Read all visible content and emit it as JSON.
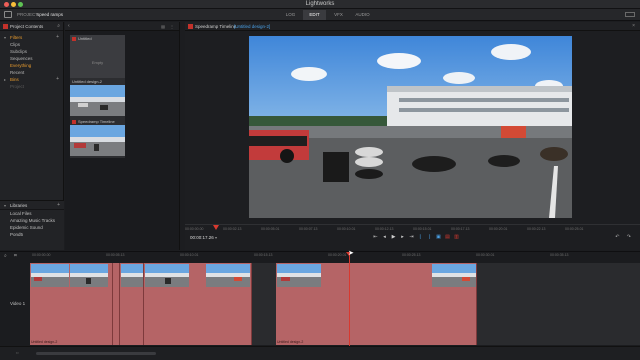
{
  "window": {
    "title": "Lightworks"
  },
  "topbar": {
    "project_label": "PROJECT",
    "project_name": "speed ramps",
    "tabs": [
      "LOG",
      "EDIT",
      "VFX",
      "AUDIO"
    ],
    "active_tab": "EDIT"
  },
  "project_panel": {
    "title": "Project Contents",
    "items": [
      {
        "label": "Filters",
        "color": "#e69a2e",
        "type": "section",
        "caret": "▾"
      },
      {
        "label": "Clips",
        "type": "child"
      },
      {
        "label": "Subclips",
        "type": "child"
      },
      {
        "label": "Sequences",
        "type": "child"
      },
      {
        "label": "Everything",
        "type": "child",
        "color": "#e69a2e"
      },
      {
        "label": "Recent",
        "type": "child"
      },
      {
        "label": "Bins",
        "color": "#e69a2e",
        "type": "section",
        "caret": "▸"
      },
      {
        "label": "Project",
        "type": "child",
        "dim": true
      }
    ]
  },
  "libraries": {
    "title": "Libraries",
    "items": [
      "Local Files",
      "Amazing Music Tracks",
      "Epidemic Sound",
      "Pond5"
    ]
  },
  "bin": {
    "tiles": [
      {
        "title": "Untitled",
        "body": "Empty",
        "kind": "empty"
      },
      {
        "title": "Untitled design-2",
        "kind": "thumb"
      },
      {
        "title": "Speedramp Timeline",
        "kind": "thumb",
        "red": true
      }
    ]
  },
  "viewer": {
    "title": "Speedramp Timeline",
    "subtitle": "[Untitled design-2]",
    "timecode": "00:00:17.26",
    "ruler_ticks": [
      "00:00:00.00",
      "00:00:02.13",
      "00:00:05.01",
      "00:00:07.13",
      "00:00:10.01",
      "00:00:12.13",
      "00:00:15.01",
      "00:00:17.13",
      "00:00:20.01",
      "00:00:22.13",
      "00:00:25.01"
    ]
  },
  "timeline": {
    "track_label": "Video 1",
    "ruler_ticks": [
      "00:00:00.00",
      "00:00:05.13",
      "00:00:10.01",
      "00:00:15.13",
      "00:00:20.01",
      "00:00:25.13",
      "00:00:30.01",
      "00:00:35.13"
    ],
    "clip_caption": "Untitled design-2"
  },
  "colors": {
    "accent_red": "#d8392f",
    "accent_orange": "#e69a2e",
    "accent_blue": "#4aa0e6",
    "clip_color": "#b56466"
  }
}
